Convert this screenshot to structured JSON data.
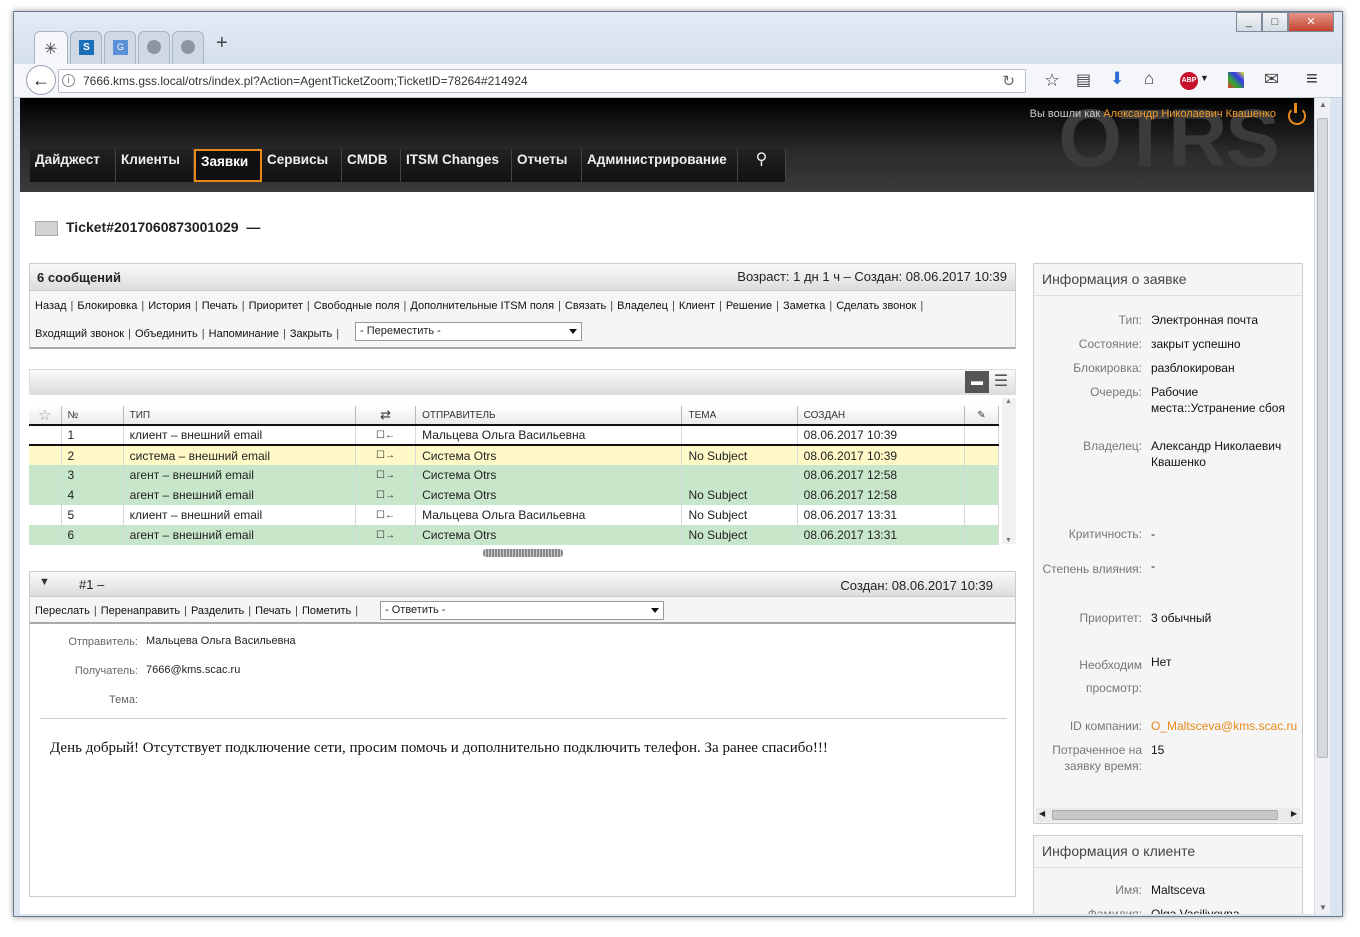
{
  "browser": {
    "url": "7666.kms.gss.local/otrs/index.pl?Action=AgentTicketZoom;TicketID=78264#214924",
    "new_tab": "+"
  },
  "header": {
    "logged_in_label": "Вы вошли как",
    "user_name": "Александр Николаевич Квашенко",
    "logo": "OTRS"
  },
  "menu": [
    {
      "label": "Дайджест"
    },
    {
      "label": "Клиенты"
    },
    {
      "label": "Заявки"
    },
    {
      "label": "Сервисы"
    },
    {
      "label": "CMDB"
    },
    {
      "label": "ITSM Changes"
    },
    {
      "label": "Отчеты"
    },
    {
      "label": "Администрирование"
    }
  ],
  "ticket": {
    "title": "Ticket#2017060873001029  —",
    "messages_count": "6 сообщений",
    "age_created": "Возраст: 1 дн 1 ч – Создан: 08.06.2017 10:39",
    "actions_row1": [
      "Назад",
      "Блокировка",
      "История",
      "Печать",
      "Приоритет",
      "Свободные поля",
      "Дополнительные ITSM поля",
      "Связать",
      "Владелец",
      "Клиент",
      "Решение",
      "Заметка",
      "Сделать звонок"
    ],
    "actions_row2": [
      "Входящий звонок",
      "Объединить",
      "Напоминание",
      "Закрыть"
    ],
    "move_select": "- Переместить -"
  },
  "articles_table": {
    "headers": [
      "№",
      "ТИП",
      "⇄",
      "ОТПРАВИТЕЛЬ",
      "ТЕМА",
      "СОЗДАН"
    ],
    "rows": [
      {
        "n": "1",
        "type": "клиент – внешний email",
        "dir": "☐←",
        "sender": "Мальцева Ольга Васильевна",
        "subject": "",
        "created": "08.06.2017 10:39"
      },
      {
        "n": "2",
        "type": "система – внешний email",
        "dir": "☐→",
        "sender": "Система Otrs",
        "subject": "No Subject",
        "created": "08.06.2017 10:39"
      },
      {
        "n": "3",
        "type": "агент – внешний email",
        "dir": "☐→",
        "sender": "Система Otrs",
        "subject": "",
        "created": "08.06.2017 12:58"
      },
      {
        "n": "4",
        "type": "агент – внешний email",
        "dir": "☐→",
        "sender": "Система Otrs",
        "subject": "No Subject",
        "created": "08.06.2017 12:58"
      },
      {
        "n": "5",
        "type": "клиент – внешний email",
        "dir": "☐←",
        "sender": "Мальцева Ольга Васильевна",
        "subject": "No Subject",
        "created": "08.06.2017 13:31"
      },
      {
        "n": "6",
        "type": "агент – внешний email",
        "dir": "☐→",
        "sender": "Система Otrs",
        "subject": "No Subject",
        "created": "08.06.2017 13:31"
      }
    ]
  },
  "article": {
    "title": "#1 –",
    "created": "Создан: 08.06.2017 10:39",
    "actions": [
      "Переслать",
      "Перенаправить",
      "Разделить",
      "Печать",
      "Пометить"
    ],
    "reply_select": "- Ответить -",
    "from_label": "Отправитель:",
    "from": "Мальцева Ольга Васильевна",
    "to_label": "Получатель:",
    "to": "7666@kms.scac.ru",
    "subject_label": "Тема:",
    "body": "День добрый! Отсутствует подключение сети, просим помочь и дополнительно подключить телефон. За ранее спасибо!!!"
  },
  "ticket_info": {
    "title": "Информация о заявке",
    "fields": [
      {
        "k": "Тип:",
        "v": "Электронная почта"
      },
      {
        "k": "Состояние:",
        "v": "закрыт успешно"
      },
      {
        "k": "Блокировка:",
        "v": "разблокирован"
      },
      {
        "k": "Очередь:",
        "v": "Рабочие места::Устранение сбоя"
      },
      {
        "k": "Владелец:",
        "v": "Александр Николаевич Квашенко"
      },
      {
        "k": "Критичность:",
        "v": "-"
      },
      {
        "k": "Степень влияния:",
        "v": "-"
      },
      {
        "k": "Приоритет:",
        "v": "3 обычный"
      },
      {
        "k": "Необходим просмотр:",
        "v": "Нет"
      },
      {
        "k": "ID компании:",
        "v": "O_Maltsceva@kms.scac.ru"
      },
      {
        "k": "Потраченное на заявку время:",
        "v": "15"
      }
    ]
  },
  "customer_info": {
    "title": "Информация о клиенте",
    "fields": [
      {
        "k": "Имя:",
        "v": "Maltsceva"
      },
      {
        "k": "Фамилия:",
        "v": "Olga Vasiliyevna"
      }
    ]
  },
  "colors": {
    "accent": "#e88a1a",
    "row_yellow": "#fff9c7",
    "row_green": "#c8e6c9"
  }
}
